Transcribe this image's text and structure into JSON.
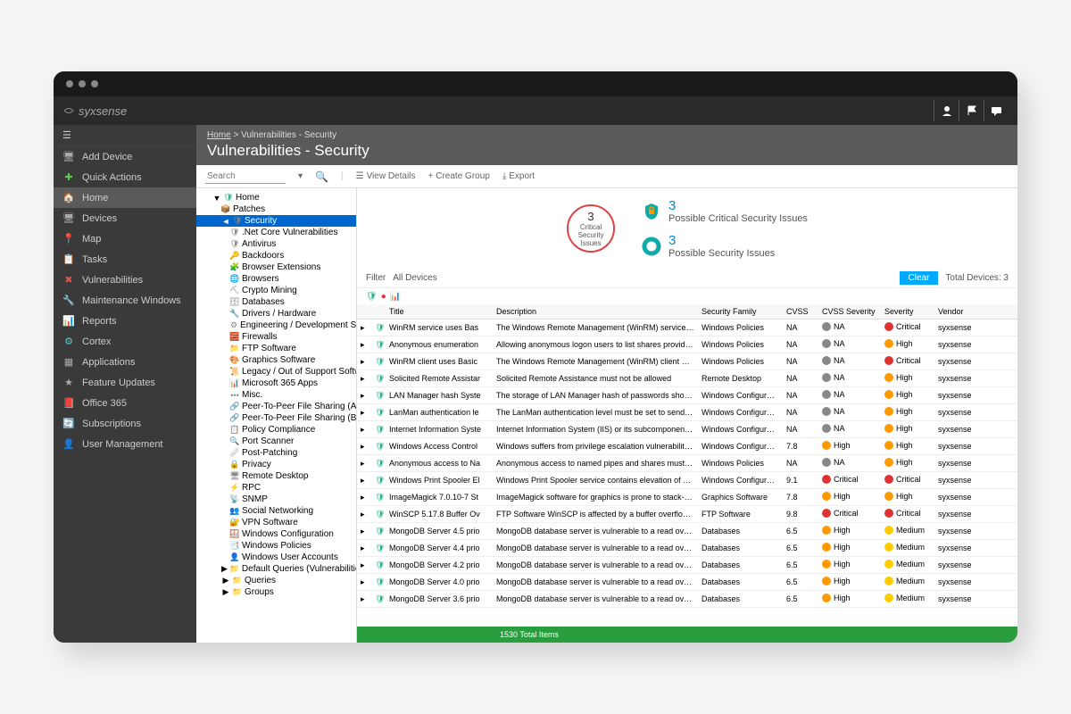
{
  "logo": "syxsense",
  "breadcrumb": {
    "home": "Home",
    "sep": ">",
    "page": "Vulnerabilities - Security"
  },
  "page_title": "Vulnerabilities - Security",
  "sidebar": {
    "items": [
      {
        "icon": "monitor",
        "label": "Add Device"
      },
      {
        "icon": "plus",
        "label": "Quick Actions"
      },
      {
        "icon": "home",
        "label": "Home",
        "active": true
      },
      {
        "icon": "monitor",
        "label": "Devices"
      },
      {
        "icon": "pin",
        "label": "Map"
      },
      {
        "icon": "list",
        "label": "Tasks"
      },
      {
        "icon": "cross",
        "label": "Vulnerabilities"
      },
      {
        "icon": "wrench",
        "label": "Maintenance Windows"
      },
      {
        "icon": "chart",
        "label": "Reports"
      },
      {
        "icon": "gear",
        "label": "Cortex"
      },
      {
        "icon": "grid",
        "label": "Applications"
      },
      {
        "icon": "star",
        "label": "Feature Updates"
      },
      {
        "icon": "office",
        "label": "Office 365"
      },
      {
        "icon": "refresh",
        "label": "Subscriptions"
      },
      {
        "icon": "user",
        "label": "User Management"
      }
    ]
  },
  "toolbar": {
    "search_placeholder": "Search",
    "view_details": "View Details",
    "create_group": "Create Group",
    "export": "Export"
  },
  "tree": [
    {
      "l": 1,
      "exp": "▼",
      "icon": "🛡",
      "label": "Home",
      "color": "#2a8"
    },
    {
      "l": 2,
      "icon": "📦",
      "label": "Patches"
    },
    {
      "l": 2,
      "exp": "◄",
      "icon": "🛡",
      "label": "Security",
      "sel": true
    },
    {
      "l": 3,
      "icon": "🛡",
      "label": ".Net Core Vulnerabilities"
    },
    {
      "l": 3,
      "icon": "🛡",
      "label": "Antivirus"
    },
    {
      "l": 3,
      "icon": "🔑",
      "label": "Backdoors"
    },
    {
      "l": 3,
      "icon": "🧩",
      "label": "Browser Extensions"
    },
    {
      "l": 3,
      "icon": "🌐",
      "label": "Browsers"
    },
    {
      "l": 3,
      "icon": "⛏",
      "label": "Crypto Mining"
    },
    {
      "l": 3,
      "icon": "🗄",
      "label": "Databases"
    },
    {
      "l": 3,
      "icon": "🔧",
      "label": "Drivers / Hardware"
    },
    {
      "l": 3,
      "icon": "⚙",
      "label": "Engineering / Development So"
    },
    {
      "l": 3,
      "icon": "🧱",
      "label": "Firewalls"
    },
    {
      "l": 3,
      "icon": "📁",
      "label": "FTP Software"
    },
    {
      "l": 3,
      "icon": "🎨",
      "label": "Graphics Software"
    },
    {
      "l": 3,
      "icon": "📜",
      "label": "Legacy / Out of Support Softwa"
    },
    {
      "l": 3,
      "icon": "📊",
      "label": "Microsoft 365 Apps"
    },
    {
      "l": 3,
      "icon": "•••",
      "label": "Misc."
    },
    {
      "l": 3,
      "icon": "🔗",
      "label": "Peer-To-Peer File Sharing (Ap"
    },
    {
      "l": 3,
      "icon": "🔗",
      "label": "Peer-To-Peer File Sharing (Bin"
    },
    {
      "l": 3,
      "icon": "📋",
      "label": "Policy Compliance"
    },
    {
      "l": 3,
      "icon": "🔍",
      "label": "Port Scanner"
    },
    {
      "l": 3,
      "icon": "🩹",
      "label": "Post-Patching"
    },
    {
      "l": 3,
      "icon": "🔒",
      "label": "Privacy"
    },
    {
      "l": 3,
      "icon": "🖥",
      "label": "Remote Desktop"
    },
    {
      "l": 3,
      "icon": "⚡",
      "label": "RPC"
    },
    {
      "l": 3,
      "icon": "📡",
      "label": "SNMP"
    },
    {
      "l": 3,
      "icon": "👥",
      "label": "Social Networking"
    },
    {
      "l": 3,
      "icon": "🔐",
      "label": "VPN Software"
    },
    {
      "l": 3,
      "icon": "🪟",
      "label": "Windows Configuration"
    },
    {
      "l": 3,
      "icon": "📑",
      "label": "Windows Policies"
    },
    {
      "l": 3,
      "icon": "👤",
      "label": "Windows User Accounts"
    },
    {
      "l": 2,
      "exp": "▶",
      "icon": "📁",
      "label": "Default Queries (Vulnerabilities)"
    },
    {
      "l": 2,
      "exp": "▶",
      "icon": "📁",
      "label": "Queries"
    },
    {
      "l": 2,
      "exp": "▶",
      "icon": "📁",
      "label": "Groups"
    }
  ],
  "summary": {
    "critical": {
      "n": "3",
      "label1": "Critical",
      "label2": "Security",
      "label3": "Issues"
    },
    "possible_critical": {
      "n": "3",
      "label": "Possible Critical Security Issues"
    },
    "possible": {
      "n": "3",
      "label": "Possible Security Issues"
    }
  },
  "filter": {
    "label": "Filter",
    "value": "All Devices",
    "clear": "Clear",
    "total": "Total Devices: 3"
  },
  "columns": [
    "",
    "",
    "Title",
    "Description",
    "Security Family",
    "CVSS",
    "CVSS Severity",
    "Severity",
    "Vendor"
  ],
  "rows": [
    {
      "t": "WinRM service uses Bas",
      "d": "The Windows Remote Management (WinRM) service must r",
      "f": "Windows Policies",
      "c": "NA",
      "cs": "NA",
      "csd": "na",
      "s": "Critical",
      "sd": "crit",
      "v": "syxsense"
    },
    {
      "t": "Anonymous enumeration",
      "d": "Allowing anonymous logon users to list shares provides atta",
      "f": "Windows Policies",
      "c": "NA",
      "cs": "NA",
      "csd": "na",
      "s": "High",
      "sd": "high",
      "v": "syxsense"
    },
    {
      "t": "WinRM client uses Basic",
      "d": "The Windows Remote Management (WinRM) client must no",
      "f": "Windows Policies",
      "c": "NA",
      "cs": "NA",
      "csd": "na",
      "s": "Critical",
      "sd": "crit",
      "v": "syxsense"
    },
    {
      "t": "Solicited Remote Assistar",
      "d": "Solicited Remote Assistance must not be allowed",
      "f": "Remote Desktop",
      "c": "NA",
      "cs": "NA",
      "csd": "na",
      "s": "High",
      "sd": "high",
      "v": "syxsense"
    },
    {
      "t": "LAN Manager hash Syste",
      "d": "The storage of LAN Manager hash of passwords should be s",
      "f": "Windows Configuration",
      "c": "NA",
      "cs": "NA",
      "csd": "na",
      "s": "High",
      "sd": "high",
      "v": "syxsense"
    },
    {
      "t": "LanMan authentication le",
      "d": "The LanMan authentication level must be set to send NTLM",
      "f": "Windows Configuration",
      "c": "NA",
      "cs": "NA",
      "csd": "na",
      "s": "High",
      "sd": "high",
      "v": "syxsense"
    },
    {
      "t": "Internet Information Syste",
      "d": "Internet Information System (IIS) or its subcomponents must",
      "f": "Windows Configuration",
      "c": "NA",
      "cs": "NA",
      "csd": "na",
      "s": "High",
      "sd": "high",
      "v": "syxsense"
    },
    {
      "t": "Windows Access Control",
      "d": "Windows suffers from privilege escalation vulnerability in AC",
      "f": "Windows Configuration",
      "c": "7.8",
      "cs": "High",
      "csd": "high",
      "s": "High",
      "sd": "high",
      "v": "syxsense"
    },
    {
      "t": "Anonymous access to Na",
      "d": "Anonymous access to named pipes and shares must be res",
      "f": "Windows Policies",
      "c": "NA",
      "cs": "NA",
      "csd": "na",
      "s": "High",
      "sd": "high",
      "v": "syxsense"
    },
    {
      "t": "Windows Print Spooler El",
      "d": "Windows Print Spooler service contains elevation of privileg",
      "f": "Windows Configuration",
      "c": "9.1",
      "cs": "Critical",
      "csd": "crit",
      "s": "Critical",
      "sd": "crit",
      "v": "syxsense"
    },
    {
      "t": "ImageMagick 7.0.10-7 St",
      "d": "ImageMagick software for graphics is prone to stack-based t",
      "f": "Graphics Software",
      "c": "7.8",
      "cs": "High",
      "csd": "high",
      "s": "High",
      "sd": "high",
      "v": "syxsense"
    },
    {
      "t": "WinSCP 5.17.8 Buffer Ov",
      "d": "FTP Software WinSCP is affected by a buffer overflow vulne",
      "f": "FTP Software",
      "c": "9.8",
      "cs": "Critical",
      "csd": "crit",
      "s": "Critical",
      "sd": "crit",
      "v": "syxsense"
    },
    {
      "t": "MongoDB Server 4.5 prio",
      "d": "MongoDB database server is vulnerable to a read overrun fl",
      "f": "Databases",
      "c": "6.5",
      "cs": "High",
      "csd": "high",
      "s": "Medium",
      "sd": "med",
      "v": "syxsense"
    },
    {
      "t": "MongoDB Server 4.4 prio",
      "d": "MongoDB database server is vulnerable to a read overrun fl",
      "f": "Databases",
      "c": "6.5",
      "cs": "High",
      "csd": "high",
      "s": "Medium",
      "sd": "med",
      "v": "syxsense"
    },
    {
      "t": "MongoDB Server 4.2 prio",
      "d": "MongoDB database server is vulnerable to a read overrun fl",
      "f": "Databases",
      "c": "6.5",
      "cs": "High",
      "csd": "high",
      "s": "Medium",
      "sd": "med",
      "v": "syxsense"
    },
    {
      "t": "MongoDB Server 4.0 prio",
      "d": "MongoDB database server is vulnerable to a read overrun fl",
      "f": "Databases",
      "c": "6.5",
      "cs": "High",
      "csd": "high",
      "s": "Medium",
      "sd": "med",
      "v": "syxsense"
    },
    {
      "t": "MongoDB Server 3.6 prio",
      "d": "MongoDB database server is vulnerable to a read overrun fl",
      "f": "Databases",
      "c": "6.5",
      "cs": "High",
      "csd": "high",
      "s": "Medium",
      "sd": "med",
      "v": "syxsense"
    }
  ],
  "footer": "1530 Total Items"
}
